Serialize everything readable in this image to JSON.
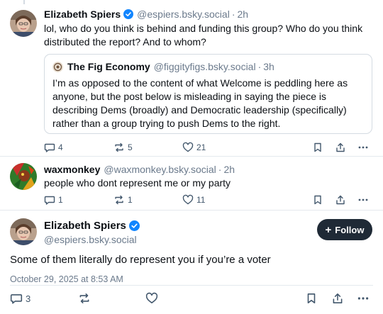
{
  "post1": {
    "name": "Elizabeth Spiers",
    "handle": "@espiers.bsky.social",
    "dot": "·",
    "time": "2h",
    "text": "lol, who do you think is behind and funding this group? Who do you think distributed the report? And to whom?",
    "quote": {
      "name": "The Fig Economy",
      "handle": "@figgityfigs.bsky.social",
      "dot": "·",
      "time": "3h",
      "text": "I’m as opposed to the content of what Welcome is peddling here as anyone, but the post below is misleading in saying the piece is describing Dems (broadly) and Democratic leadership (specifically) rather than a group trying to push Dems to the right."
    },
    "reply_count": "4",
    "repost_count": "5",
    "like_count": "21"
  },
  "post2": {
    "name": "waxmonkey",
    "handle": "@waxmonkey.bsky.social",
    "dot": "·",
    "time": "2h",
    "text": "people who dont represent me or my party",
    "reply_count": "1",
    "repost_count": "1",
    "like_count": "11"
  },
  "post3": {
    "name": "Elizabeth Spiers",
    "handle": "@espiers.bsky.social",
    "follow_label": "Follow",
    "text": "Some of them literally do represent you if you’re a voter",
    "timestamp": "October 29, 2025 at 8:53 AM",
    "reply_count": "3"
  },
  "colors": {
    "verified": "#1185fe",
    "accent_dark": "#1f2a36",
    "muted": "#6b7a8c"
  }
}
